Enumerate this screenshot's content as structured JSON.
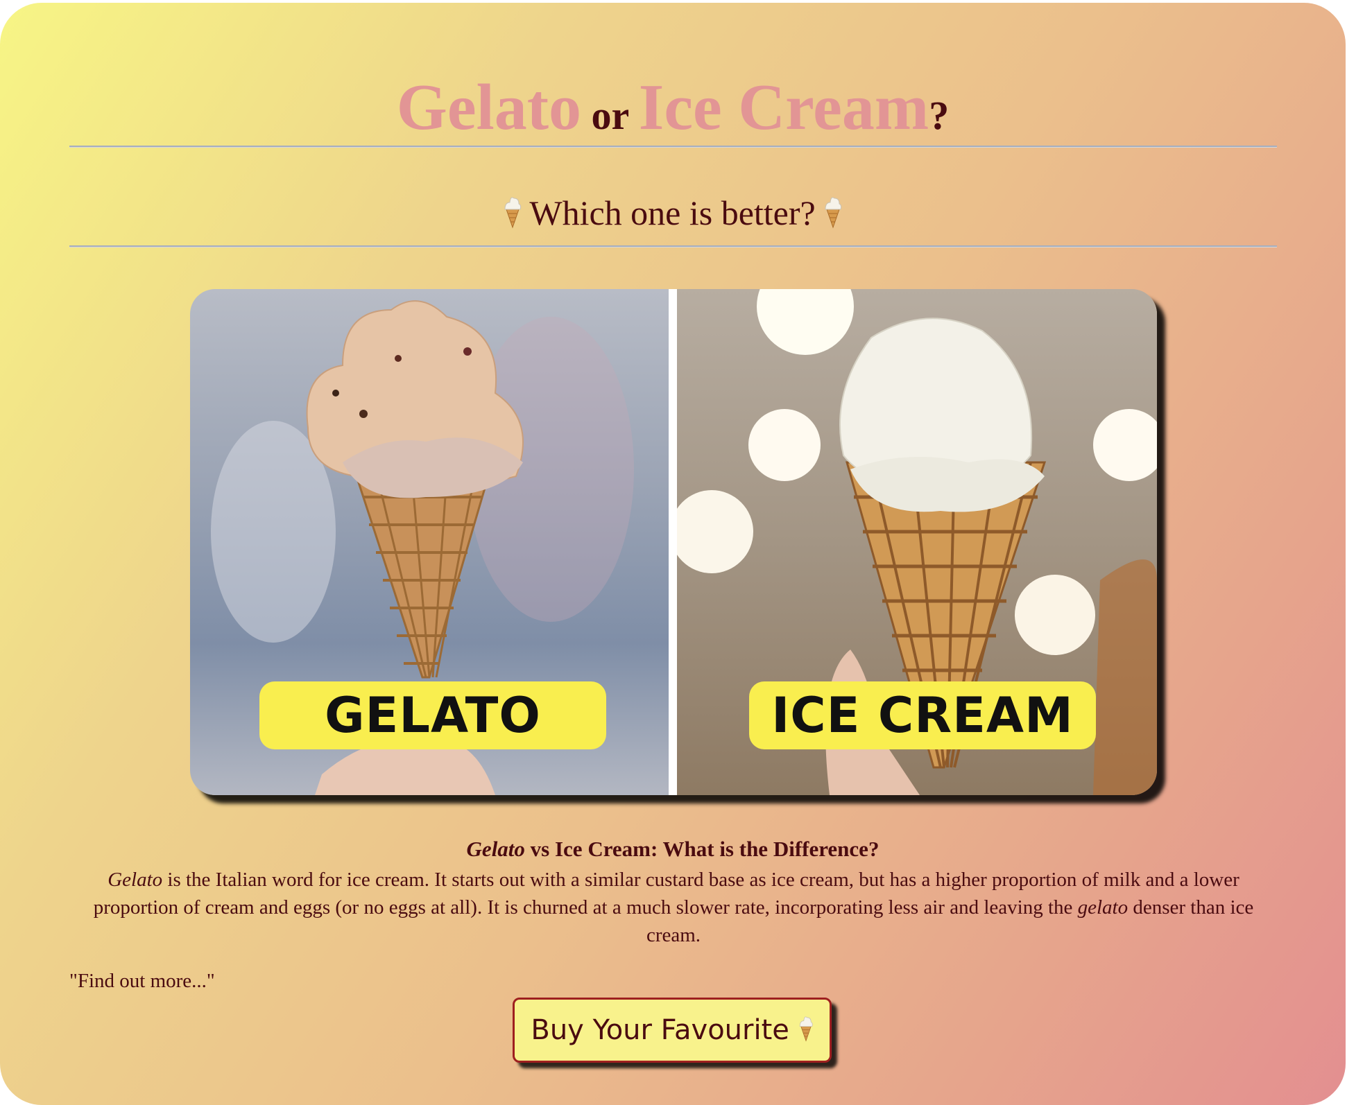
{
  "title": {
    "word1": "Gelato",
    "connector": "or",
    "word2": "Ice Cream",
    "punct": "?"
  },
  "subtitle": "Which one is better?",
  "image": {
    "left_label": "GELATO",
    "right_label": "ICE CREAM"
  },
  "description": {
    "heading_em": "Gelato",
    "heading_rest": " vs Ice Cream: What is the Difference?",
    "em1": "Gelato",
    "text1": " is the Italian word for ice cream. It starts out with a similar custard base as ice cream, but has a higher proportion of milk and a lower proportion of cream and eggs (or no eggs at all). It is churned at a much slower rate, incorporating less air and leaving the ",
    "em2": "gelato",
    "text2": " denser than ice cream."
  },
  "find_more": "\"Find out more...\"",
  "button": {
    "label": "Buy Your Favourite"
  },
  "colors": {
    "accent": "#e29595",
    "text": "#4a0b10",
    "label_bg": "#f9ee4f",
    "button_bg": "#f8f28c"
  }
}
